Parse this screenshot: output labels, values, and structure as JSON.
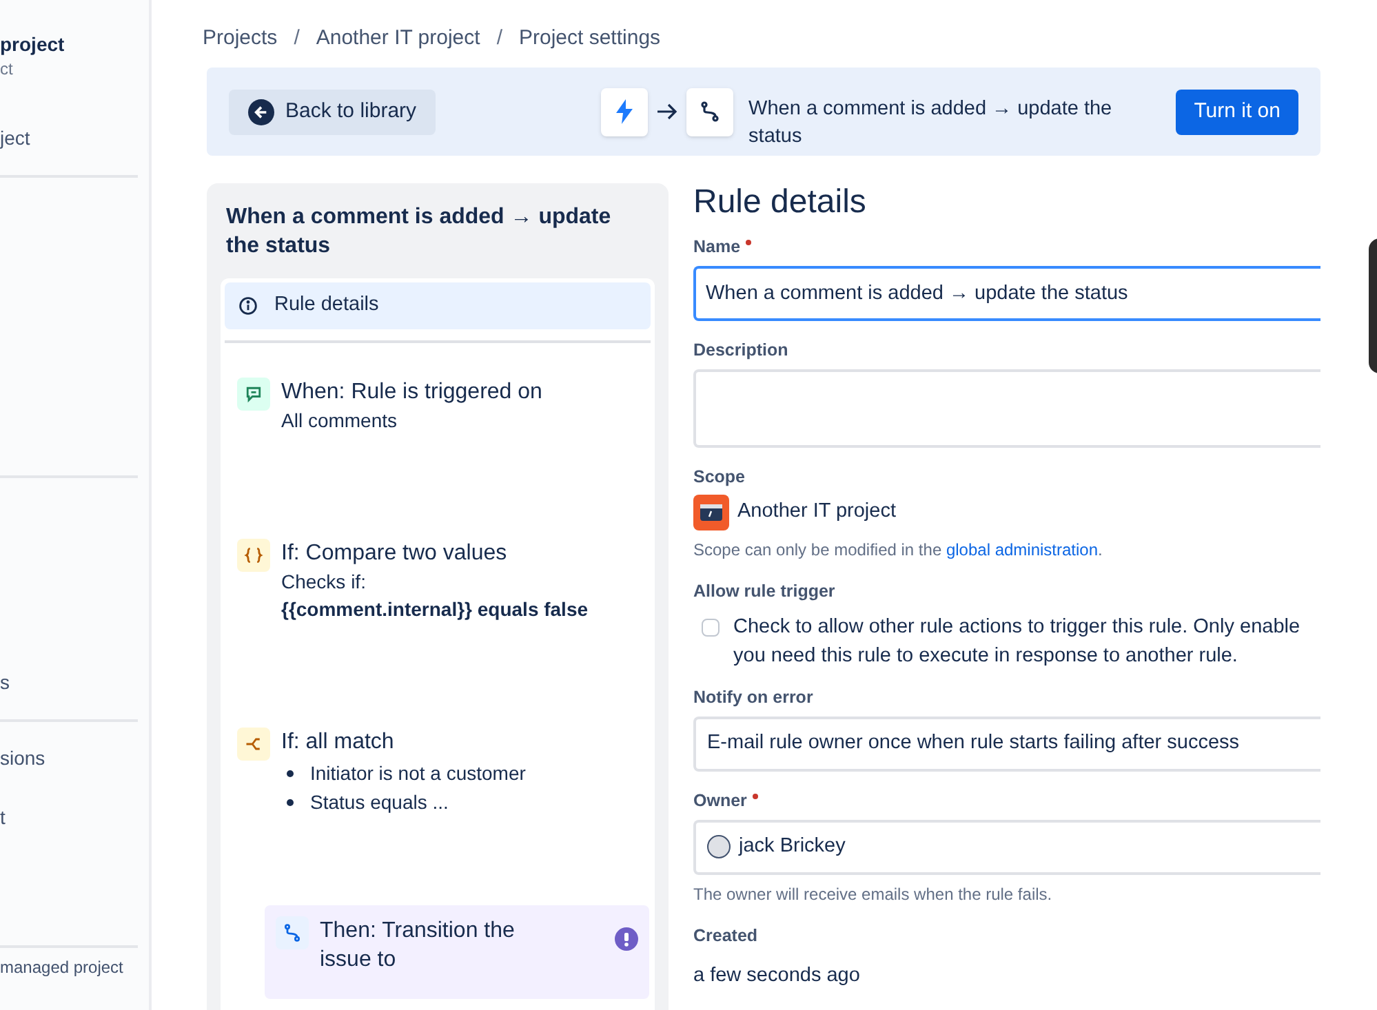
{
  "sidebar": {
    "title": "project",
    "subtitle": "ct",
    "groups": [
      [
        "ject"
      ],
      [
        "s"
      ],
      [
        "sions",
        "t"
      ]
    ],
    "footer": "managed project"
  },
  "breadcrumbs": [
    {
      "kind": "link",
      "text": "Projects"
    },
    {
      "kind": "separator",
      "text": "/"
    },
    {
      "kind": "link",
      "text": "Another IT project"
    },
    {
      "kind": "separator",
      "text": "/"
    },
    {
      "kind": "link",
      "text": "Project settings"
    }
  ],
  "banner": {
    "back_button": "Back to library",
    "rule_summary": "When a comment is added → update the status",
    "primary_button": "Turn it on"
  },
  "rule_panel": {
    "title": "When a comment is added → update the status",
    "nav": [
      {
        "label": "Rule details",
        "selected": true
      }
    ],
    "steps": [
      {
        "kind": "trigger",
        "title": "When: Rule is triggered on",
        "lines": [
          {
            "text": "All comments",
            "bold": false
          }
        ],
        "warning": false,
        "selected": false
      },
      {
        "kind": "condition",
        "title": "If: Compare two values",
        "lines": [
          {
            "text": "Checks if:",
            "bold": false
          },
          {
            "text": "{{comment.internal}} equals false",
            "bold": true
          }
        ],
        "warning": false,
        "selected": false
      },
      {
        "kind": "branch",
        "title": "If: all match",
        "bullets": [
          "Initiator is not a customer",
          "Status equals ..."
        ],
        "warning": false,
        "selected": false,
        "children": [
          {
            "kind": "action",
            "title": "Then: Transition the issue to",
            "warning": true,
            "selected": false
          }
        ]
      }
    ]
  },
  "rule_details": {
    "heading": "Rule details",
    "name": {
      "label": "Name",
      "required": true,
      "value": "When a comment is added → update the status",
      "focused": true
    },
    "description": {
      "label": "Description"
    },
    "scope": {
      "label": "Scope",
      "project": "Another IT project",
      "help": "Scope can only be modified in the",
      "help_link": "global administration",
      "help_end": "."
    },
    "allow_rule_trigger": {
      "label": "Allow rule trigger",
      "checked": false,
      "text": "Check to allow other rule actions to trigger this rule. Only enable you need this rule to execute in response to another rule."
    },
    "notify_on_error": {
      "label": "Notify on error",
      "value": "E-mail rule owner once when rule starts failing after success"
    },
    "owner": {
      "label": "Owner",
      "required": true,
      "value": "jack Brickey",
      "help": "The owner will receive emails when the rule fails."
    },
    "created": {
      "label": "Created",
      "value": "a few seconds ago"
    }
  }
}
